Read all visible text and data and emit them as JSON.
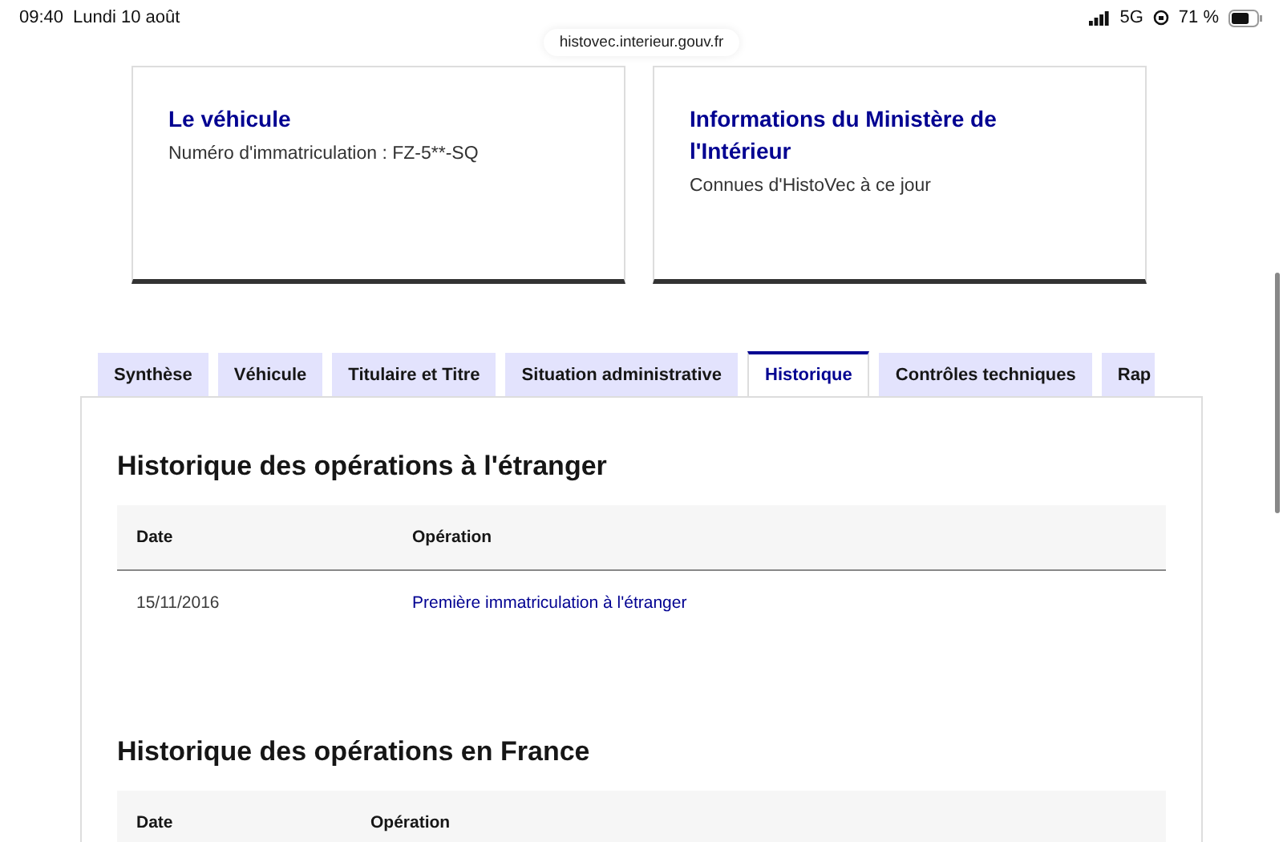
{
  "status_bar": {
    "time": "09:40",
    "date": "Lundi 10 août",
    "network": "5G",
    "battery": "71 %"
  },
  "url_bar": {
    "url": "histovec.interieur.gouv.fr"
  },
  "cards": [
    {
      "title": "Le véhicule",
      "text": "Numéro d'immatriculation : FZ-5**-SQ"
    },
    {
      "title": "Informations du Ministère de l'Intérieur",
      "text": "Connues d'HistoVec à ce jour"
    }
  ],
  "tabs": [
    {
      "label": "Synthèse",
      "selected": false
    },
    {
      "label": "Véhicule",
      "selected": false
    },
    {
      "label": "Titulaire et Titre",
      "selected": false
    },
    {
      "label": "Situation administrative",
      "selected": false
    },
    {
      "label": "Historique",
      "selected": true
    },
    {
      "label": "Contrôles techniques",
      "selected": false
    },
    {
      "label": "Rap",
      "selected": false
    }
  ],
  "sections": [
    {
      "title": "Historique des opérations à l'étranger",
      "columns": [
        "Date",
        "Opération"
      ],
      "rows": [
        {
          "date": "15/11/2016",
          "operation": "Première immatriculation à l'étranger"
        }
      ]
    },
    {
      "title": "Historique des opérations en France",
      "columns": [
        "Date",
        "Opération"
      ]
    }
  ]
}
